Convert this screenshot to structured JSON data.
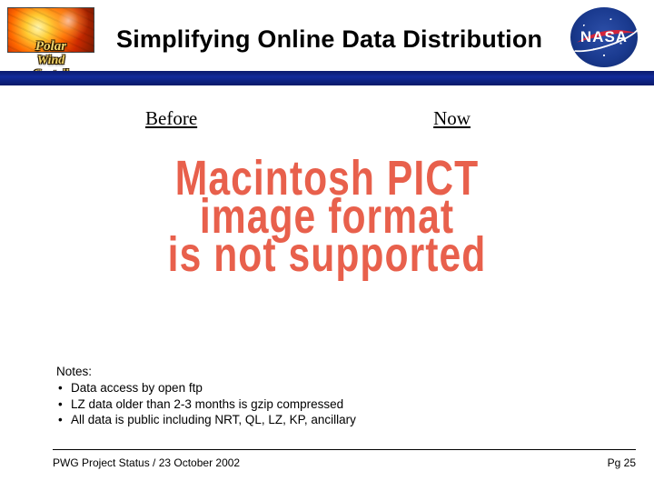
{
  "header": {
    "title": "Simplifying Online Data Distribution",
    "left_logo": {
      "line1": "Polar",
      "line2": "Wind",
      "line3": "Geotail"
    },
    "right_logo": {
      "text": "NASA"
    }
  },
  "columns": {
    "before": "Before",
    "now": "Now"
  },
  "placeholder": {
    "line1": "Macintosh PICT",
    "line2": "image format",
    "line3": "is not supported"
  },
  "notes": {
    "heading": "Notes:",
    "items": [
      "Data access by open ftp",
      "LZ data older than 2-3 months is gzip compressed",
      "All data is public including NRT, QL, LZ, KP, ancillary"
    ]
  },
  "footer": {
    "left": "PWG Project Status / 23 October 2002",
    "right": "Pg 25"
  }
}
